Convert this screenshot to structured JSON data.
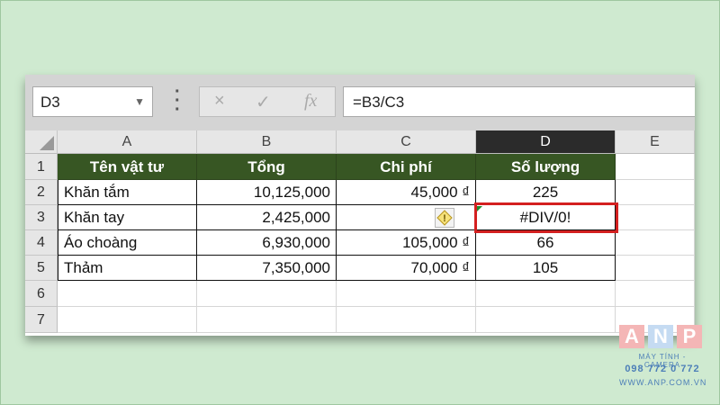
{
  "formula_bar": {
    "name_box": "D3",
    "cancel_icon": "×",
    "enter_icon": "✓",
    "fx_label": "fx",
    "formula": "=B3/C3"
  },
  "columns": [
    "A",
    "B",
    "C",
    "D",
    "E"
  ],
  "selected_column": "D",
  "rows": [
    "1",
    "2",
    "3",
    "4",
    "5",
    "6",
    "7"
  ],
  "table": {
    "headers": [
      "Tên vật tư",
      "Tổng",
      "Chi phí",
      "Số lượng"
    ],
    "rows": [
      [
        "Khăn tắm",
        "10,125,000",
        "45,000 ₫",
        "225"
      ],
      [
        "Khăn tay",
        "2,425,000",
        "",
        "#DIV/0!"
      ],
      [
        "Áo choàng",
        "6,930,000",
        "105,000 ₫",
        "66"
      ],
      [
        "Thảm",
        "7,350,000",
        "70,000 ₫",
        "105"
      ]
    ]
  },
  "warning_icon": "!",
  "colors": {
    "header_fill": "#375623",
    "error_highlight": "#d42020",
    "selected_column_header": "#2b2b2b"
  },
  "logo": {
    "letters": [
      "A",
      "N",
      "P"
    ],
    "tagline": "MÁY TÍNH - CAMERA",
    "phone": "098 772 0 772",
    "website": "WWW.ANP.COM.VN"
  }
}
